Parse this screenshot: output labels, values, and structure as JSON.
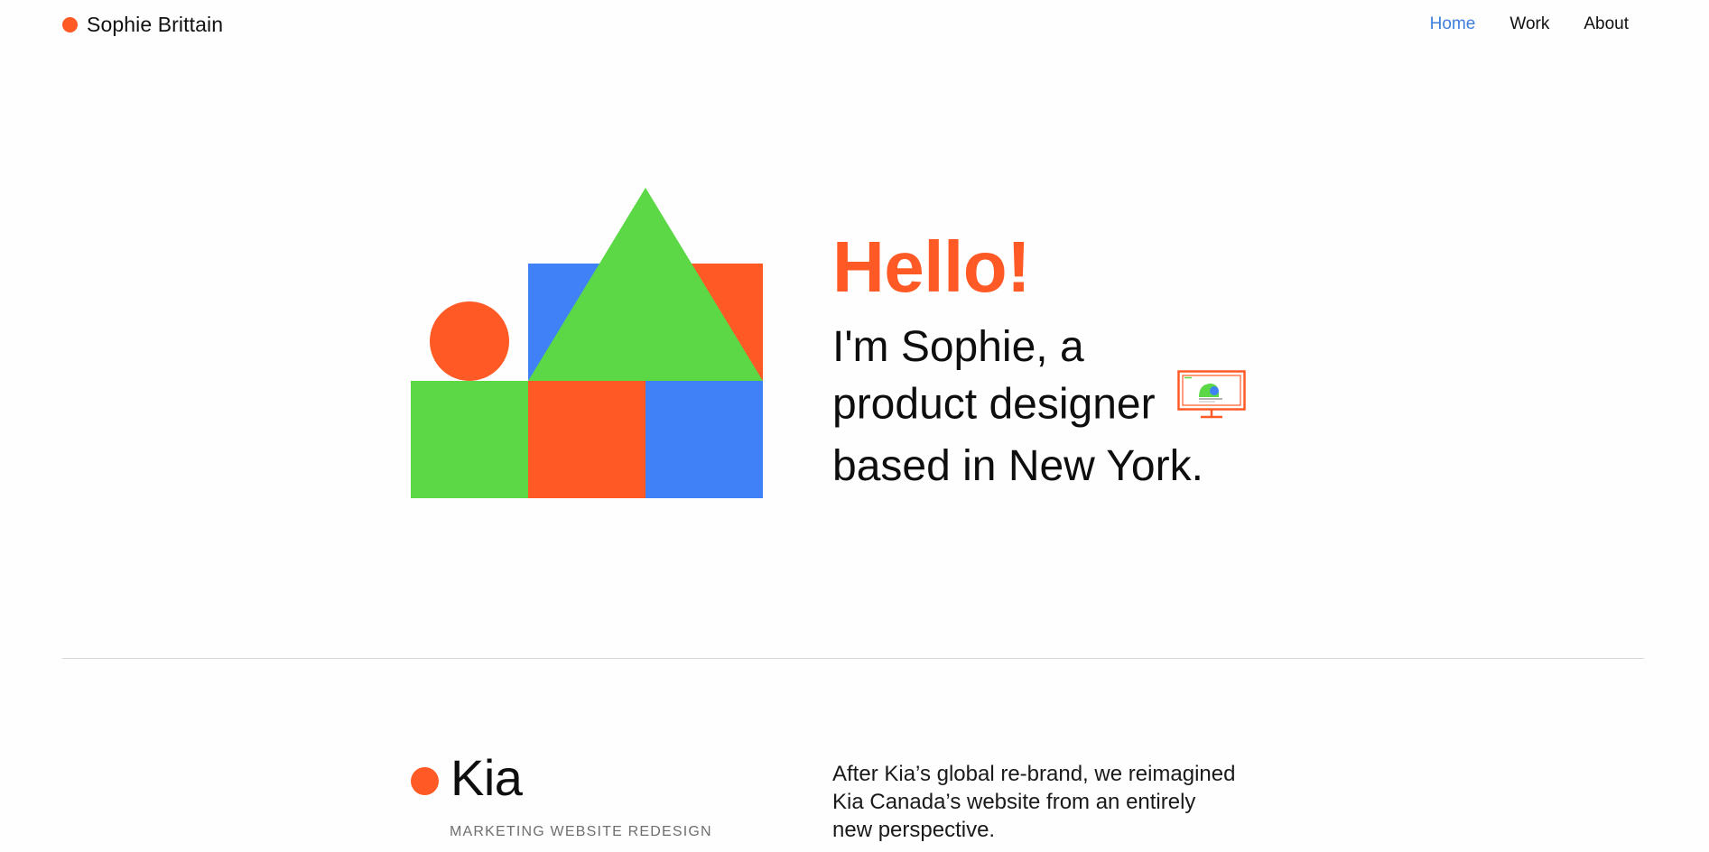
{
  "header": {
    "brand_name": "Sophie Brittain",
    "brand_icon": "orange-dot-logo",
    "nav": [
      {
        "label": "Home",
        "active": true
      },
      {
        "label": "Work",
        "active": false
      },
      {
        "label": "About",
        "active": false
      }
    ]
  },
  "hero": {
    "greeting": "Hello!",
    "intro_lines": [
      "I'm Sophie, a",
      "product designer",
      "based in New York."
    ],
    "illustration_icon": "geometric-shapes-house-illustration",
    "inline_icon": "monitor-icon"
  },
  "project": {
    "title": "Kia",
    "subtitle": "MARKETING WEBSITE REDESIGN",
    "description_lines": [
      "After Kia’s global re-brand, we reimagined",
      "Kia Canada’s website from an entirely",
      "new perspective."
    ]
  },
  "colors": {
    "accent_orange": "#ff5a26",
    "green": "#5cd846",
    "blue": "#4081f8",
    "nav_active": "#3f7fdc",
    "divider": "#d6d6d6"
  }
}
